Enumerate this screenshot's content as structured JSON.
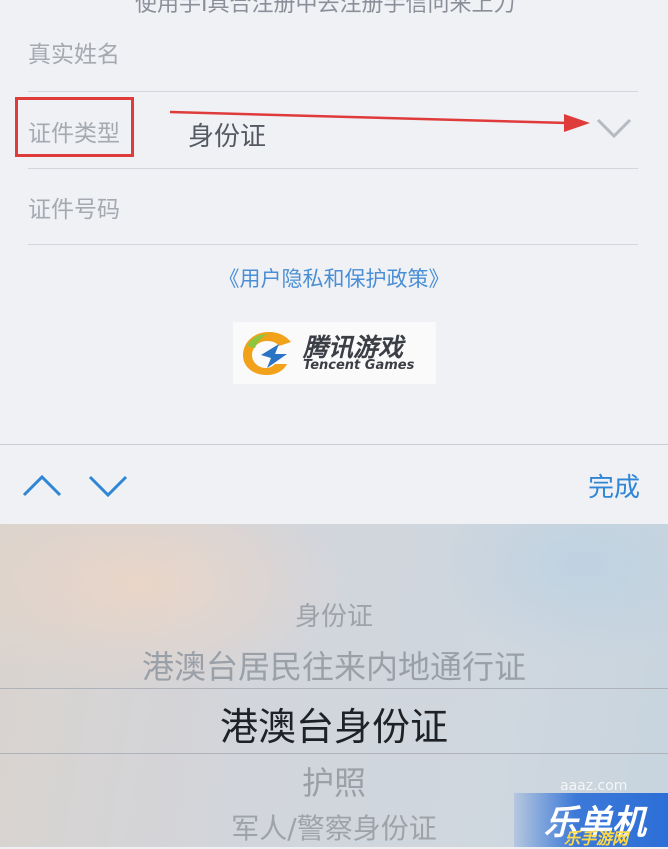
{
  "form": {
    "cut_off_text": "使用手I具合注册中去注册手信问来上力",
    "real_name_label": "真实姓名",
    "id_type_label": "证件类型",
    "id_type_value": "身份证",
    "id_number_label": "证件号码",
    "policy_link": "《用户隐私和保护政策》"
  },
  "logo": {
    "cn": "腾讯游戏",
    "en": "Tencent Games"
  },
  "toolbar": {
    "done_label": "完成"
  },
  "picker": {
    "options": [
      "身份证",
      "港澳台居民往来内地通行证",
      "港澳台身份证",
      "护照",
      "军人/警察身份证"
    ],
    "selected": "港澳台身份证"
  },
  "watermark": {
    "site": "aaaz.com",
    "text": "乐单机",
    "sub": "乐手游网"
  },
  "colors": {
    "annotation_red": "#e03b3b",
    "link_blue": "#4a8fd6",
    "done_blue": "#2f86d6"
  },
  "icons": {
    "dropdown": "chevron-down-icon",
    "prev": "chevron-up-icon",
    "next": "chevron-down-icon"
  }
}
